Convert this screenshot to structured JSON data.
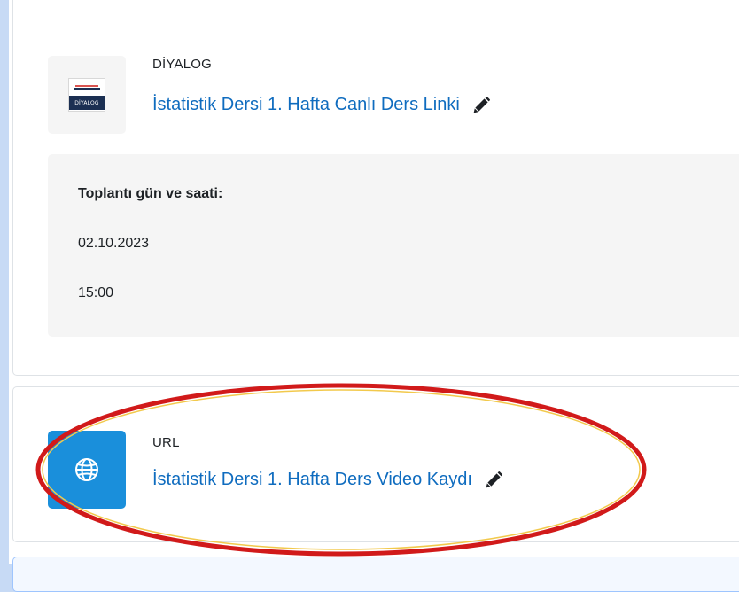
{
  "activities": [
    {
      "type_label": "DİYALOG",
      "title": "İstatistik Dersi 1. Hafta Canlı Ders Linki",
      "icon": "diyalog-logo-icon",
      "logo_text": "DİYALOG",
      "description": {
        "heading": "Toplantı gün ve saati:",
        "date": "02.10.2023",
        "time": "15:00"
      }
    },
    {
      "type_label": "URL",
      "title": "İstatistik Dersi 1. Hafta Ders Video Kaydı",
      "icon": "globe-icon"
    }
  ],
  "colors": {
    "link": "#0f6cbf",
    "url_icon_bg": "#1a8fdb",
    "annotation": "#d11a1a",
    "page_bg": "#c7daf5"
  }
}
